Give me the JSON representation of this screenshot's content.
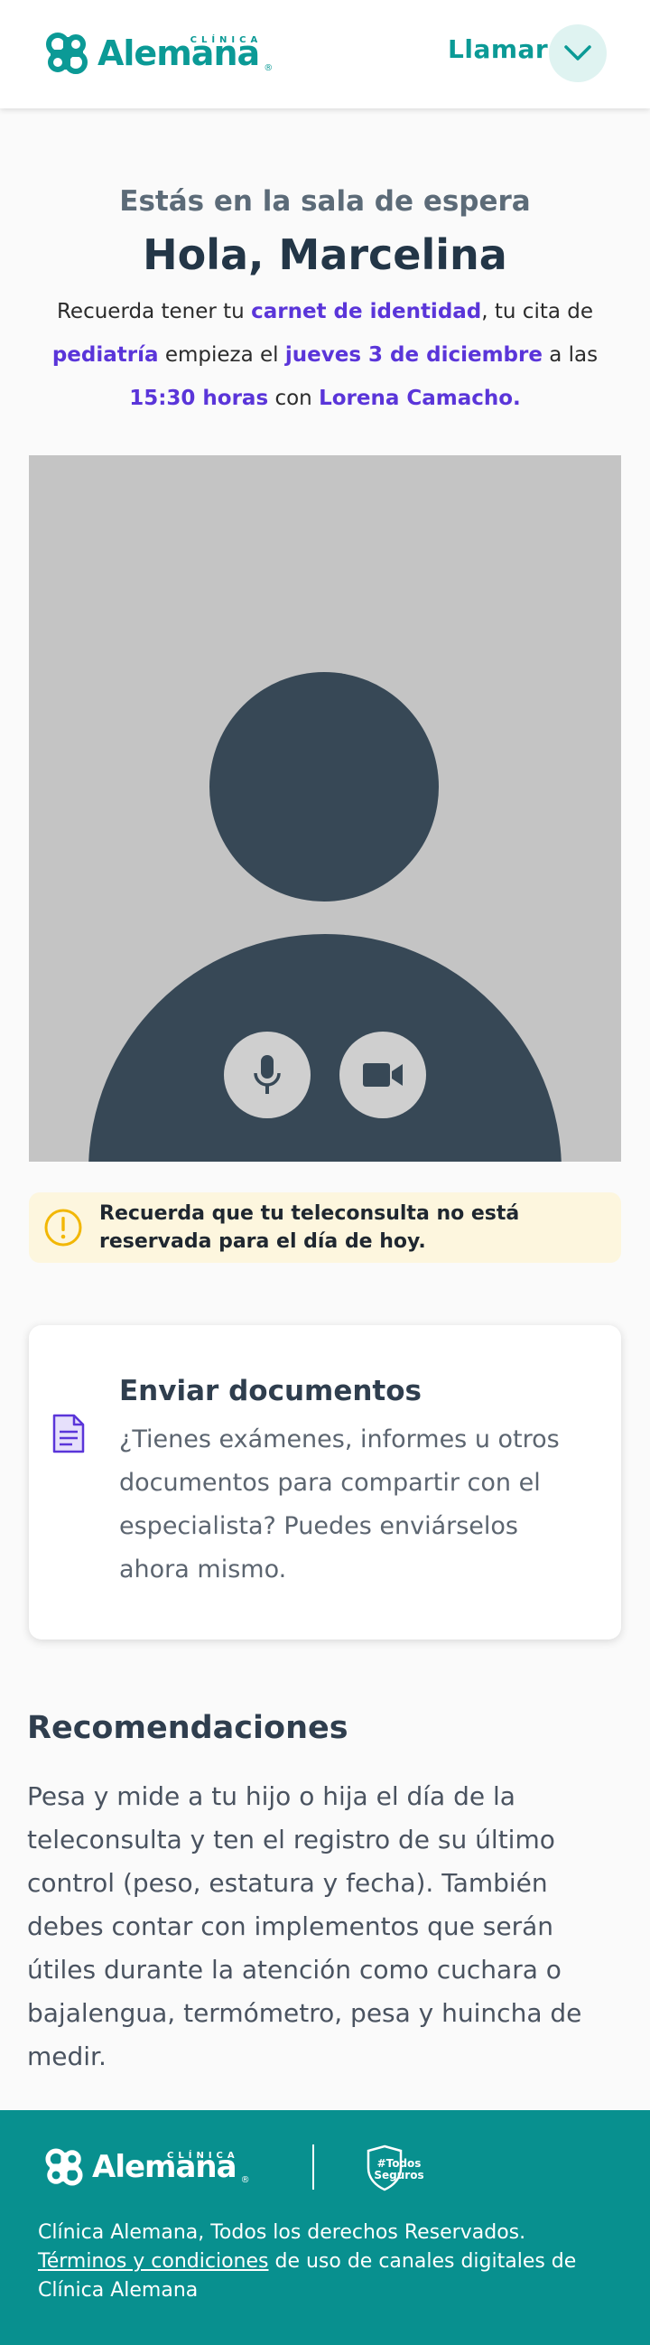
{
  "header": {
    "logo_small": "CLÍNICA",
    "logo_word": "Alemana",
    "logo_reg": "®",
    "call_label": "Llamar",
    "chevron_icon": "chevron-down-icon"
  },
  "intro": {
    "subtitle": "Estás en la sala de espera",
    "greeting": "Hola, Marcelina",
    "message": {
      "p1": "Recuerda tener tu ",
      "h1": "carnet de identidad",
      "p2": ", tu cita de ",
      "h2": "pediatría",
      "p3": " empieza el ",
      "h3": "jueves 3 de diciembre",
      "p4": " a las ",
      "h4": "15:30 horas",
      "p5": " con ",
      "h5": "Lorena Camacho."
    }
  },
  "video": {
    "mic_icon": "microphone-icon",
    "camera_icon": "video-camera-icon"
  },
  "alert": {
    "icon": "exclamation-circle-icon",
    "text": "Recuerda que tu teleconsulta no está reservada para el día de hoy."
  },
  "documents_card": {
    "icon": "document-icon",
    "title": "Enviar documentos",
    "body": "¿Tienes exámenes, informes u otros documentos para compartir con el especialista? Puedes enviárselos ahora mismo."
  },
  "recommendations": {
    "title": "Recomendaciones",
    "body": "Pesa y mide a tu hijo o hija el día de la teleconsulta y ten el registro de su último control (peso, estatura y fecha). También debes contar con implementos que serán útiles durante la atención como cuchara o bajalengua, termómetro, pesa y huincha de medir."
  },
  "footer": {
    "logo_small": "CLÍNICA",
    "logo_word": "Alemana",
    "logo_reg": "®",
    "badge_line1": "#Todos",
    "badge_line2": "Seguros",
    "rights": "Clínica Alemana, Todos los derechos Reservados.",
    "terms_link": "Términos y condiciones",
    "terms_rest": " de uso de canales digitales de Clínica Alemana"
  },
  "colors": {
    "brand_teal": "#0b9a96",
    "highlight_purple": "#5a35d9",
    "avatar_dark": "#374856",
    "alert_bg": "#fdf6de",
    "alert_icon": "#f2b705"
  }
}
